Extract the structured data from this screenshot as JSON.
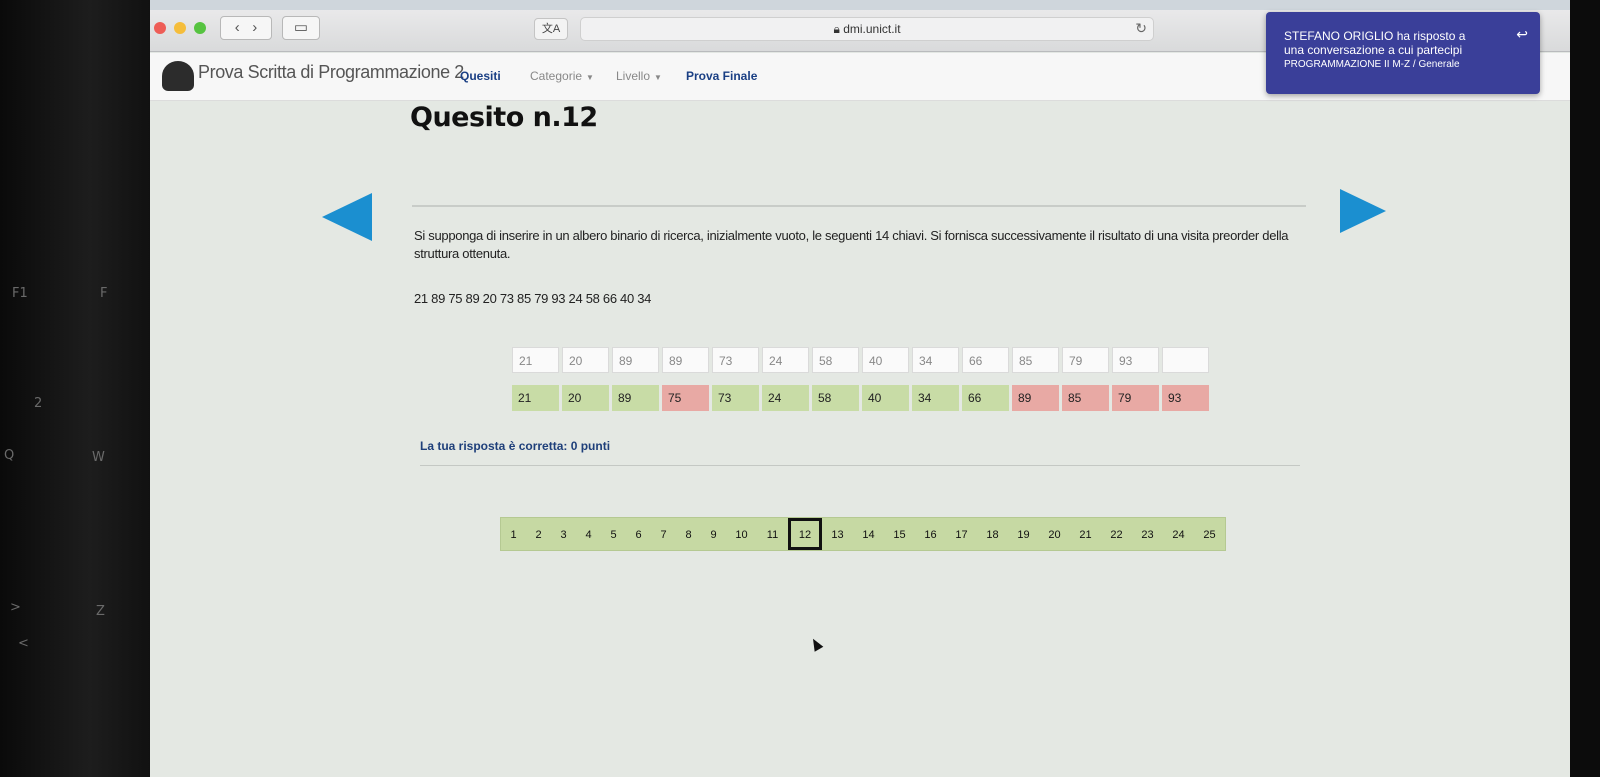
{
  "bezel": {
    "keys": [
      "F1",
      "F",
      "2",
      "Q",
      "W",
      ">",
      "Z",
      "<"
    ]
  },
  "browser": {
    "url": "dmi.unict.it",
    "translate_label": "文A",
    "back_icon": "chevron-left-icon",
    "forward_icon": "chevron-right-icon"
  },
  "notification": {
    "line1": "STEFANO ORIGLIO ha risposto a",
    "line2": "una conversazione a cui partecipi",
    "line3": "PROGRAMMAZIONE II M-Z / Generale"
  },
  "nav": {
    "brand": "Prova Scritta di Programmazione 2",
    "links": {
      "quesiti": "Quesiti",
      "categorie": "Categorie",
      "livello": "Livello",
      "prova_finale": "Prova Finale"
    }
  },
  "question": {
    "title": "Quesito n.12",
    "text": "Si supponga di inserire in un albero binario di ricerca, inizialmente vuoto, le seguenti 14 chiavi. Si fornisca successivamente il risultato di una visita preorder della struttura ottenuta.",
    "keys": "21 89 75 89 20 73 85 79 93 24 58 66 40 34"
  },
  "answer_inputs": [
    "21",
    "20",
    "89",
    "89",
    "73",
    "24",
    "58",
    "40",
    "34",
    "66",
    "85",
    "79",
    "93",
    ""
  ],
  "solution": [
    {
      "value": "21",
      "status": "ok"
    },
    {
      "value": "20",
      "status": "ok"
    },
    {
      "value": "89",
      "status": "ok"
    },
    {
      "value": "75",
      "status": "bad"
    },
    {
      "value": "73",
      "status": "ok"
    },
    {
      "value": "24",
      "status": "ok"
    },
    {
      "value": "58",
      "status": "ok"
    },
    {
      "value": "40",
      "status": "ok"
    },
    {
      "value": "34",
      "status": "ok"
    },
    {
      "value": "66",
      "status": "ok"
    },
    {
      "value": "89",
      "status": "bad"
    },
    {
      "value": "85",
      "status": "bad"
    },
    {
      "value": "79",
      "status": "bad"
    },
    {
      "value": "93",
      "status": "bad"
    }
  ],
  "feedback": "La tua risposta è corretta: 0 punti",
  "pagination": {
    "pages": [
      "1",
      "2",
      "3",
      "4",
      "5",
      "6",
      "7",
      "8",
      "9",
      "10",
      "11",
      "12",
      "13",
      "14",
      "15",
      "16",
      "17",
      "18",
      "19",
      "20",
      "21",
      "22",
      "23",
      "24",
      "25"
    ],
    "current": "12"
  },
  "colors": {
    "accent_arrow": "#1b8fd0",
    "correct": "#c8dca6",
    "wrong": "#e8a9a4",
    "notification_bg": "#3a3f99"
  }
}
